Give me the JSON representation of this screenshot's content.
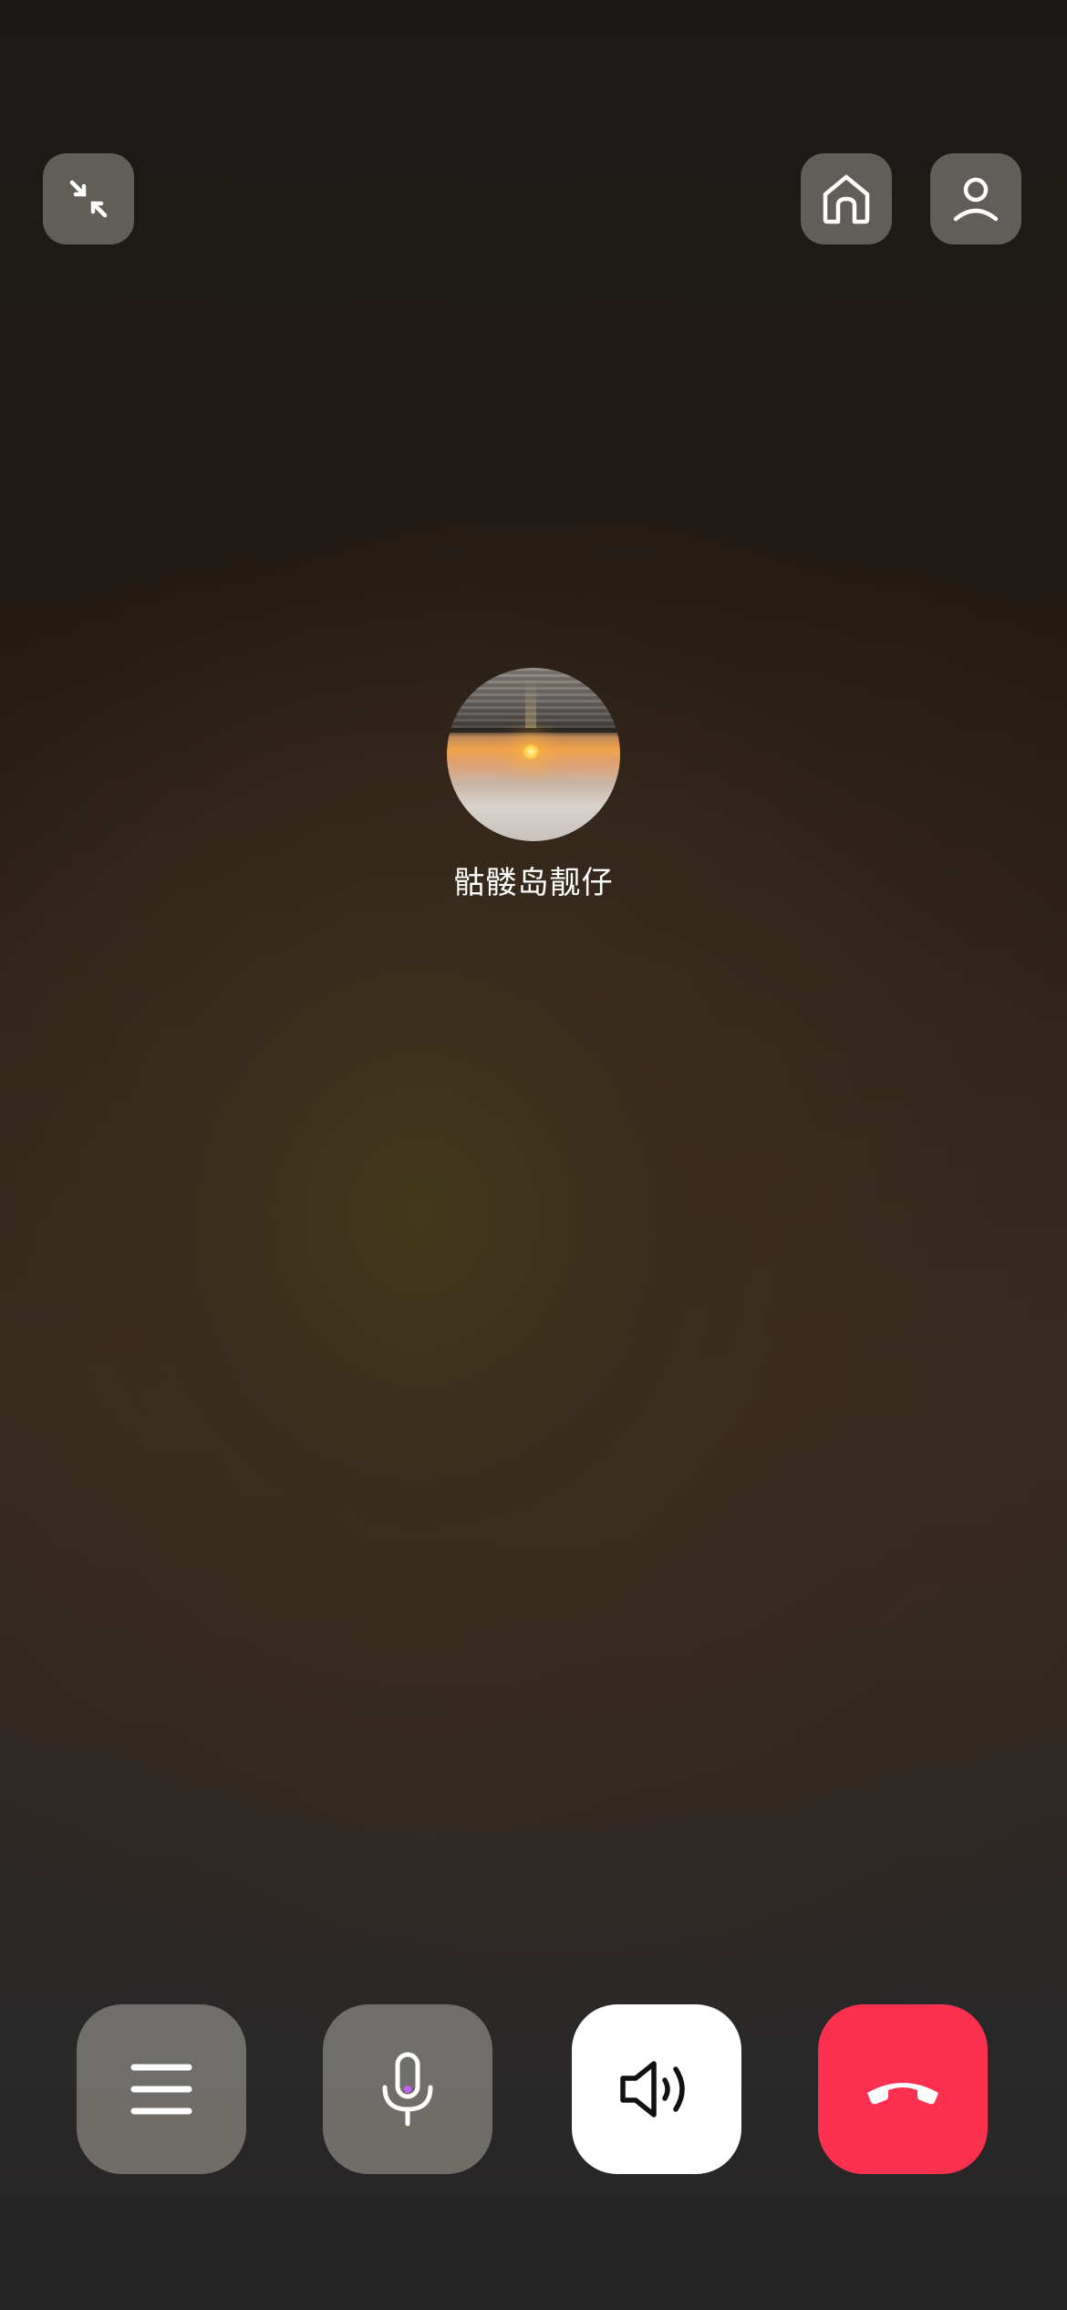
{
  "call": {
    "caller_name": "骷髅岛靓仔"
  },
  "top_controls": {
    "minimize_icon": "minimize-arrows-icon",
    "home_icon": "home-icon",
    "contact_icon": "person-icon"
  },
  "bottom_controls": {
    "menu_icon": "menu-icon",
    "mic_icon": "microphone-icon",
    "speaker_icon": "speaker-icon",
    "hangup_icon": "hang-up-phone-icon",
    "hangup_color": "#fe3050",
    "speaker_bg": "#ffffff"
  }
}
